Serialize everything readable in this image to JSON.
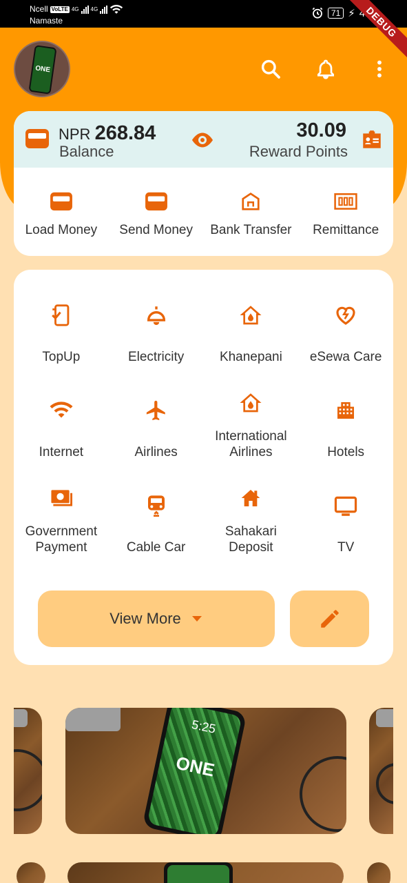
{
  "status_bar": {
    "carrier": "Ncell",
    "volte": "VoLTE",
    "network1": "4G",
    "network2": "4G",
    "carrier2": "Namaste",
    "battery": "71",
    "time": "4:27",
    "debug_label": "DEBUG"
  },
  "header": {
    "avatar_text": "ONE",
    "icons": [
      "search-icon",
      "bell-icon",
      "more-vert-icon"
    ]
  },
  "balance": {
    "currency": "NPR",
    "amount": "268.84",
    "label": "Balance",
    "reward_amount": "30.09",
    "reward_label": "Reward Points"
  },
  "quick_actions": [
    {
      "label": "Load Money",
      "icon": "wallet-icon"
    },
    {
      "label": "Send Money",
      "icon": "wallet-icon"
    },
    {
      "label": "Bank Transfer",
      "icon": "bank-icon"
    },
    {
      "label": "Remittance",
      "icon": "money-icon"
    }
  ],
  "services": [
    {
      "label": "TopUp",
      "icon": "phone-topup-icon"
    },
    {
      "label": "Electricity",
      "icon": "bulb-icon"
    },
    {
      "label": "Khanepani",
      "icon": "water-home-icon"
    },
    {
      "label": "eSewa Care",
      "icon": "broken-heart-icon"
    },
    {
      "label": "Internet",
      "icon": "wifi-icon"
    },
    {
      "label": "Airlines",
      "icon": "airplane-icon"
    },
    {
      "label": "International Airlines",
      "icon": "water-home-icon"
    },
    {
      "label": "Hotels",
      "icon": "building-icon"
    },
    {
      "label": "Government Payment",
      "icon": "payment-card-icon"
    },
    {
      "label": "Cable Car",
      "icon": "car-icon"
    },
    {
      "label": "Sahakari Deposit",
      "icon": "house-icon"
    },
    {
      "label": "TV",
      "icon": "tv-icon"
    }
  ],
  "actions": {
    "view_more": "View More",
    "edit_icon": "pencil-icon"
  },
  "banner": {
    "phone_time": "5:25",
    "phone_text": "ONE"
  },
  "colors": {
    "primary": "#FF9800",
    "icon": "#E8650A",
    "background": "#FFE0B2",
    "button": "#FFCC80",
    "balance_strip": "#E0F2F1"
  }
}
